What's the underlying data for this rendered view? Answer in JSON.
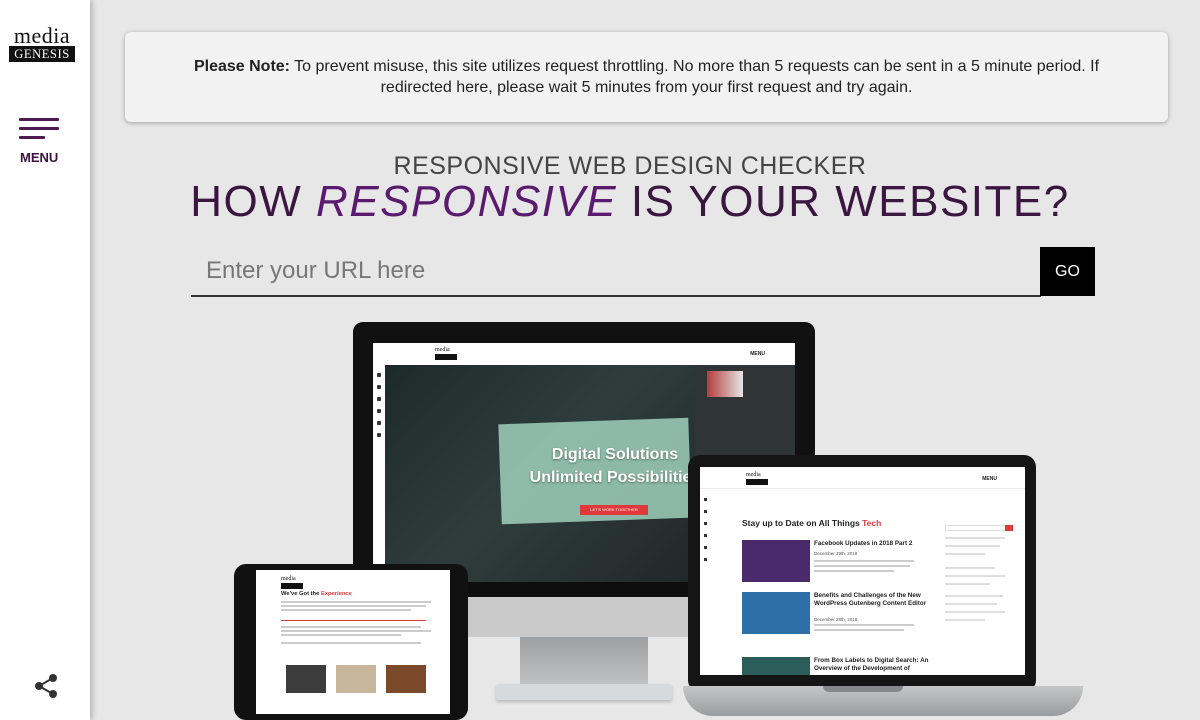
{
  "sidebar": {
    "logo_top": "media",
    "logo_bottom": "GENESIS",
    "menu_label": "MENU"
  },
  "notice": {
    "bold": "Please Note:",
    "text": " To prevent misuse, this site utilizes request throttling. No more than 5 requests can be sent in a 5 minute period. If redirected here, please wait 5 minutes from your first request and try again."
  },
  "header": {
    "subtitle": "RESPONSIVE WEB DESIGN CHECKER",
    "title_part1": "HOW ",
    "title_emphasis": "RESPONSIVE",
    "title_part2": " IS YOUR WEBSITE?"
  },
  "form": {
    "url_placeholder": "Enter your URL here",
    "url_value": "",
    "go_label": "GO"
  },
  "preview": {
    "desktop_menu": "MENU",
    "desktop_hero_line1": "Digital Solutions",
    "desktop_hero_line2": "Unlimited Possibilities",
    "desktop_cta": "LET'S WORK TOGETHER",
    "laptop_heading_prefix": "Stay up to Date on All Things ",
    "laptop_heading_accent": "Tech",
    "laptop_menu": "MENU",
    "laptop_posts": [
      {
        "title": "Facebook Updates in 2018 Part 2",
        "date": "December 29th, 2018",
        "thumb_color": "#4a2a6a"
      },
      {
        "title": "Benefits and Challenges of the New WordPress Gutenberg Content Editor",
        "date": "December 28th, 2018",
        "thumb_color": "#2f6fa8"
      },
      {
        "title": "From Box Labels to Digital Search: An Overview of the Development of",
        "date": "",
        "thumb_color": "#2b5d5a"
      }
    ],
    "tablet_heading_prefix": "We've Got the ",
    "tablet_heading_accent": "Experience"
  },
  "colors": {
    "brand_purple": "#4d1a52",
    "accent_red": "#e0383b",
    "background": "#e7e7e7"
  },
  "icons": {
    "menu": "hamburger-icon",
    "share": "share-icon"
  }
}
